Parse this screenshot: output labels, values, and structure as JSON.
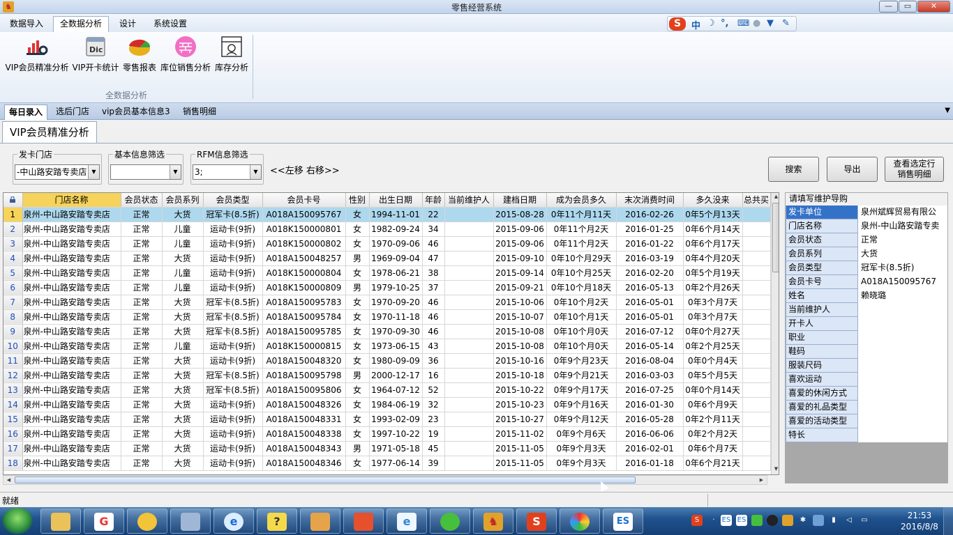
{
  "window": {
    "title": "零售经营系统",
    "minimize": "—",
    "maximize": "▭",
    "close": "✕"
  },
  "menu": [
    "数据导入",
    "全数据分析",
    "设计",
    "系统设置"
  ],
  "ribbon": {
    "buttons": [
      "VIP会员精准分析",
      "VIP开卡统计",
      "零售报表",
      "库位销售分析",
      "库存分析"
    ],
    "group_label": "全数据分析"
  },
  "ime": {
    "s": "S",
    "mode": "中",
    "moon": "☽",
    "punct": "°,"
  },
  "doc_tabs": [
    "每日录入",
    "选后门店",
    "vip会员基本信息3",
    "销售明细"
  ],
  "section_title": "VIP会员精准分析",
  "filters": {
    "store": {
      "label": "发卡门店",
      "value": "-中山路安踏专卖店"
    },
    "basic": {
      "label": "基本信息筛选",
      "value": ""
    },
    "rfm": {
      "label": "RFM信息筛选",
      "value": "3;"
    },
    "move_text": "<<左移  右移>>"
  },
  "actions": {
    "search": "搜索",
    "export": "导出",
    "view_line1": "查看选定行",
    "view_line2": "销售明细"
  },
  "table": {
    "headers": [
      "门店名称",
      "会员状态",
      "会员系列",
      "会员类型",
      "会员卡号",
      "性别",
      "出生日期",
      "年龄",
      "当前维护人",
      "建档日期",
      "成为会员多久",
      "末次消费时间",
      "多久没来",
      "总共买"
    ],
    "rows": [
      [
        "1",
        "泉州-中山路安踏专卖店",
        "正常",
        "大货",
        "冠军卡(8.5折)",
        "A018A150095767",
        "女",
        "1994-11-01",
        "22",
        "",
        "2015-08-28",
        "0年11个月11天",
        "2016-02-26",
        "0年5个月13天"
      ],
      [
        "2",
        "泉州-中山路安踏专卖店",
        "正常",
        "儿童",
        "运动卡(9折)",
        "A018K150000801",
        "女",
        "1982-09-24",
        "34",
        "",
        "2015-09-06",
        "0年11个月2天",
        "2016-01-25",
        "0年6个月14天"
      ],
      [
        "3",
        "泉州-中山路安踏专卖店",
        "正常",
        "儿童",
        "运动卡(9折)",
        "A018K150000802",
        "女",
        "1970-09-06",
        "46",
        "",
        "2015-09-06",
        "0年11个月2天",
        "2016-01-22",
        "0年6个月17天"
      ],
      [
        "4",
        "泉州-中山路安踏专卖店",
        "正常",
        "大货",
        "运动卡(9折)",
        "A018A150048257",
        "男",
        "1969-09-04",
        "47",
        "",
        "2015-09-10",
        "0年10个月29天",
        "2016-03-19",
        "0年4个月20天"
      ],
      [
        "5",
        "泉州-中山路安踏专卖店",
        "正常",
        "儿童",
        "运动卡(9折)",
        "A018K150000804",
        "女",
        "1978-06-21",
        "38",
        "",
        "2015-09-14",
        "0年10个月25天",
        "2016-02-20",
        "0年5个月19天"
      ],
      [
        "6",
        "泉州-中山路安踏专卖店",
        "正常",
        "儿童",
        "运动卡(9折)",
        "A018K150000809",
        "男",
        "1979-10-25",
        "37",
        "",
        "2015-09-21",
        "0年10个月18天",
        "2016-05-13",
        "0年2个月26天"
      ],
      [
        "7",
        "泉州-中山路安踏专卖店",
        "正常",
        "大货",
        "冠军卡(8.5折)",
        "A018A150095783",
        "女",
        "1970-09-20",
        "46",
        "",
        "2015-10-06",
        "0年10个月2天",
        "2016-05-01",
        "0年3个月7天"
      ],
      [
        "8",
        "泉州-中山路安踏专卖店",
        "正常",
        "大货",
        "冠军卡(8.5折)",
        "A018A150095784",
        "女",
        "1970-11-18",
        "46",
        "",
        "2015-10-07",
        "0年10个月1天",
        "2016-05-01",
        "0年3个月7天"
      ],
      [
        "9",
        "泉州-中山路安踏专卖店",
        "正常",
        "大货",
        "冠军卡(8.5折)",
        "A018A150095785",
        "女",
        "1970-09-30",
        "46",
        "",
        "2015-10-08",
        "0年10个月0天",
        "2016-07-12",
        "0年0个月27天"
      ],
      [
        "10",
        "泉州-中山路安踏专卖店",
        "正常",
        "儿童",
        "运动卡(9折)",
        "A018K150000815",
        "女",
        "1973-06-15",
        "43",
        "",
        "2015-10-08",
        "0年10个月0天",
        "2016-05-14",
        "0年2个月25天"
      ],
      [
        "11",
        "泉州-中山路安踏专卖店",
        "正常",
        "大货",
        "运动卡(9折)",
        "A018A150048320",
        "女",
        "1980-09-09",
        "36",
        "",
        "2015-10-16",
        "0年9个月23天",
        "2016-08-04",
        "0年0个月4天"
      ],
      [
        "12",
        "泉州-中山路安踏专卖店",
        "正常",
        "大货",
        "冠军卡(8.5折)",
        "A018A150095798",
        "男",
        "2000-12-17",
        "16",
        "",
        "2015-10-18",
        "0年9个月21天",
        "2016-03-03",
        "0年5个月5天"
      ],
      [
        "13",
        "泉州-中山路安踏专卖店",
        "正常",
        "大货",
        "冠军卡(8.5折)",
        "A018A150095806",
        "女",
        "1964-07-12",
        "52",
        "",
        "2015-10-22",
        "0年9个月17天",
        "2016-07-25",
        "0年0个月14天"
      ],
      [
        "14",
        "泉州-中山路安踏专卖店",
        "正常",
        "大货",
        "运动卡(9折)",
        "A018A150048326",
        "女",
        "1984-06-19",
        "32",
        "",
        "2015-10-23",
        "0年9个月16天",
        "2016-01-30",
        "0年6个月9天"
      ],
      [
        "15",
        "泉州-中山路安踏专卖店",
        "正常",
        "大货",
        "运动卡(9折)",
        "A018A150048331",
        "女",
        "1993-02-09",
        "23",
        "",
        "2015-10-27",
        "0年9个月12天",
        "2016-05-28",
        "0年2个月11天"
      ],
      [
        "16",
        "泉州-中山路安踏专卖店",
        "正常",
        "大货",
        "运动卡(9折)",
        "A018A150048338",
        "女",
        "1997-10-22",
        "19",
        "",
        "2015-11-02",
        "0年9个月6天",
        "2016-06-06",
        "0年2个月2天"
      ],
      [
        "17",
        "泉州-中山路安踏专卖店",
        "正常",
        "大货",
        "运动卡(9折)",
        "A018A150048343",
        "男",
        "1971-05-18",
        "45",
        "",
        "2015-11-05",
        "0年9个月3天",
        "2016-02-01",
        "0年6个月7天"
      ],
      [
        "18",
        "泉州-中山路安踏专卖店",
        "正常",
        "大货",
        "运动卡(9折)",
        "A018A150048346",
        "女",
        "1977-06-14",
        "39",
        "",
        "2015-11-05",
        "0年9个月3天",
        "2016-01-18",
        "0年6个月21天"
      ]
    ]
  },
  "guide": {
    "title": "请填写维护导购",
    "fields": [
      {
        "key": "发卡单位",
        "value": "泉州斌辉贸易有限公"
      },
      {
        "key": "门店名称",
        "value": "泉州-中山路安踏专卖"
      },
      {
        "key": "会员状态",
        "value": "正常"
      },
      {
        "key": "会员系列",
        "value": "大货"
      },
      {
        "key": "会员类型",
        "value": "冠军卡(8.5折)"
      },
      {
        "key": "会员卡号",
        "value": "A018A150095767"
      },
      {
        "key": "姓名",
        "value": "赖晓璐"
      },
      {
        "key": "当前维护人",
        "value": ""
      },
      {
        "key": "开卡人",
        "value": ""
      },
      {
        "key": "职业",
        "value": ""
      },
      {
        "key": "鞋码",
        "value": ""
      },
      {
        "key": "服装尺码",
        "value": ""
      },
      {
        "key": "喜欢运动",
        "value": ""
      },
      {
        "key": "喜爱的休闲方式",
        "value": ""
      },
      {
        "key": "喜爱的礼品类型",
        "value": ""
      },
      {
        "key": "喜爱的活动类型",
        "value": ""
      },
      {
        "key": "特长",
        "value": ""
      }
    ]
  },
  "status": "就绪",
  "clock": {
    "time": "21:53",
    "date": "2016/8/8"
  },
  "colors": {
    "selected_row": "#aed8ee",
    "highlight_header": "#f6d35a",
    "selected_field": "#3472c8"
  }
}
